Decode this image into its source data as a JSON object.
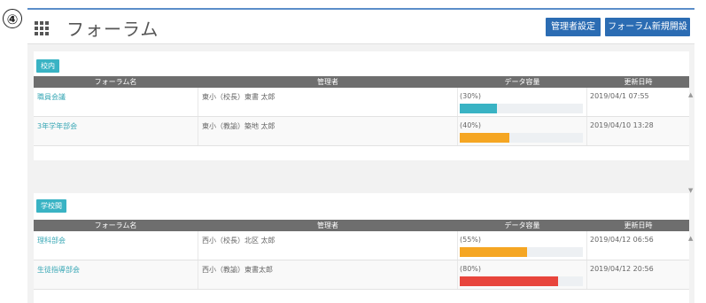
{
  "step_number": "④",
  "header": {
    "title": "フォーラム",
    "admin_button": "管理者設定",
    "new_forum_button": "フォーラム新規開設"
  },
  "columns": {
    "name": "フォーラム名",
    "manager": "管理者",
    "usage": "データ容量",
    "updated": "更新日時"
  },
  "sections": [
    {
      "badge": "校内",
      "rows": [
        {
          "name": "職員会議",
          "manager": "東小（校長）東書 太郎",
          "usage_label": "(30%)",
          "usage": 0.3,
          "color": "#39b3c4",
          "updated": "2019/04/1 07:55"
        },
        {
          "name": "3年学年部会",
          "manager": "東小（教諭）築地 太郎",
          "usage_label": "(40%)",
          "usage": 0.4,
          "color": "#f5a623",
          "updated": "2019/04/10 13:28"
        }
      ]
    },
    {
      "badge": "学校間",
      "rows": [
        {
          "name": "理科部会",
          "manager": "西小（校長）北区 太郎",
          "usage_label": "(55%)",
          "usage": 0.55,
          "color": "#f5a623",
          "updated": "2019/04/12 06:56"
        },
        {
          "name": "生徒指導部会",
          "manager": "西小（教諭）東書太郎",
          "usage_label": "(80%)",
          "usage": 0.8,
          "color": "#e8453c",
          "updated": "2019/04/12 20:56"
        }
      ]
    }
  ],
  "icons": {
    "menu": "grid-icon",
    "scroll_up": "scroll-up-icon",
    "scroll_down": "scroll-down-icon"
  }
}
